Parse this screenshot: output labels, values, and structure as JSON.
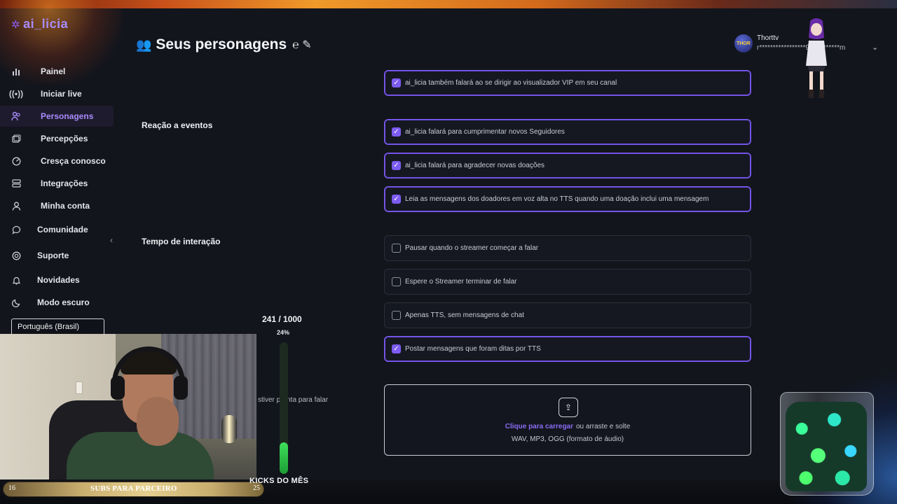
{
  "app": {
    "logo": "ai_licia"
  },
  "sidebar": {
    "items": [
      {
        "label": "Painel",
        "icon": "bar-chart-icon"
      },
      {
        "label": "Iniciar live",
        "icon": "broadcast-icon"
      },
      {
        "label": "Personagens",
        "icon": "users-icon",
        "active": true
      },
      {
        "label": "Percepções",
        "icon": "images-icon"
      },
      {
        "label": "Cresça conosco",
        "icon": "gauge-icon"
      },
      {
        "label": "Integrações",
        "icon": "server-icon"
      },
      {
        "label": "Minha conta",
        "icon": "user-icon"
      },
      {
        "label": "Comunidade",
        "icon": "chat-icon"
      },
      {
        "label": "Suporte",
        "icon": "lifebuoy-icon"
      },
      {
        "label": "Novidades",
        "icon": "bell-icon"
      },
      {
        "label": "Modo escuro",
        "icon": "moon-icon"
      }
    ],
    "language": "Português (Brasil)"
  },
  "header": {
    "title": "Seus personagens",
    "user_name": "Thorttv",
    "user_email": "r*****************9@g*******m",
    "avatar_text": "THOR"
  },
  "sections": {
    "events_label": "Reação a eventos",
    "timing_label": "Tempo de interação"
  },
  "options": [
    {
      "label": "ai_licia também falará ao se dirigir ao visualizador VIP em seu canal",
      "checked": true
    },
    {
      "label": "ai_licia falará para cumprimentar novos Seguidores",
      "checked": true
    },
    {
      "label": "ai_licia falará para agradecer novas doações",
      "checked": true
    },
    {
      "label": "Leia as mensagens dos doadores em voz alta no TTS quando uma doação inclui uma mensagem",
      "checked": true
    },
    {
      "label": "Pausar quando o streamer começar a falar",
      "checked": false
    },
    {
      "label": "Espere o Streamer terminar de falar",
      "checked": false
    },
    {
      "label": "Apenas TTS, sem mensagens de chat",
      "checked": false
    },
    {
      "label": "Postar mensagens que foram ditas por TTS",
      "checked": true
    }
  ],
  "upload": {
    "partial_label": "stiver pronta para falar",
    "link": "Clique para carregar",
    "text": "ou arraste e solte",
    "formats": "WAV, MP3, OGG (formato de áudio)"
  },
  "overlay": {
    "goal_counter": "241 / 1000",
    "goal_percent": "24%",
    "goal_fraction": 0.24,
    "goal_title": "KICKS DO MÊS",
    "subs_current": "16",
    "subs_label": "SUBS PARA PARCEIRO",
    "subs_target": "25"
  },
  "colors": {
    "accent": "#7c5cf0",
    "background": "#12151c",
    "goal_fill": "#3fe05a"
  }
}
